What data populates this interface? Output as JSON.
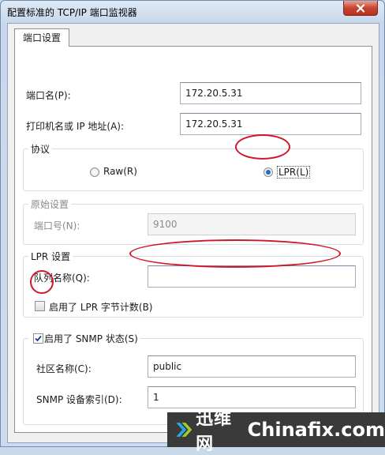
{
  "window": {
    "title": "配置标准的 TCP/IP 端口监视器"
  },
  "tabs": [
    {
      "label": "端口设置",
      "active": true
    }
  ],
  "port_name": {
    "label": "端口名(P):",
    "value": "172.20.5.31"
  },
  "printer_address": {
    "label": "打印机名或 IP 地址(A):",
    "value": "172.20.5.31"
  },
  "protocol": {
    "title": "协议",
    "options": [
      {
        "label": "Raw(R)",
        "selected": false
      },
      {
        "label": "LPR(L)",
        "selected": true
      }
    ]
  },
  "raw_settings": {
    "title": "原始设置",
    "port_number": {
      "label": "端口号(N):",
      "value": "9100"
    }
  },
  "lpr_settings": {
    "title": "LPR 设置",
    "queue_name": {
      "label": "队列名称(Q):",
      "value": ""
    },
    "byte_counting": {
      "label": "启用了 LPR 字节计数(B)",
      "checked": false
    }
  },
  "snmp": {
    "label": "启用了 SNMP 状态(S)",
    "checked": true,
    "community": {
      "label": "社区名称(C):",
      "value": "public"
    },
    "device_index": {
      "label": "SNMP 设备索引(D):",
      "value": "1"
    }
  },
  "watermark": {
    "cn": "迅维网",
    "en": "Chinafix.com"
  },
  "colors": {
    "annotation": "#d1172a",
    "radio_dot": "#1f6fc7",
    "close_button": "#c8442f"
  },
  "icons": [
    "close-icon",
    "check-icon",
    "chinafix-logo-icon"
  ]
}
